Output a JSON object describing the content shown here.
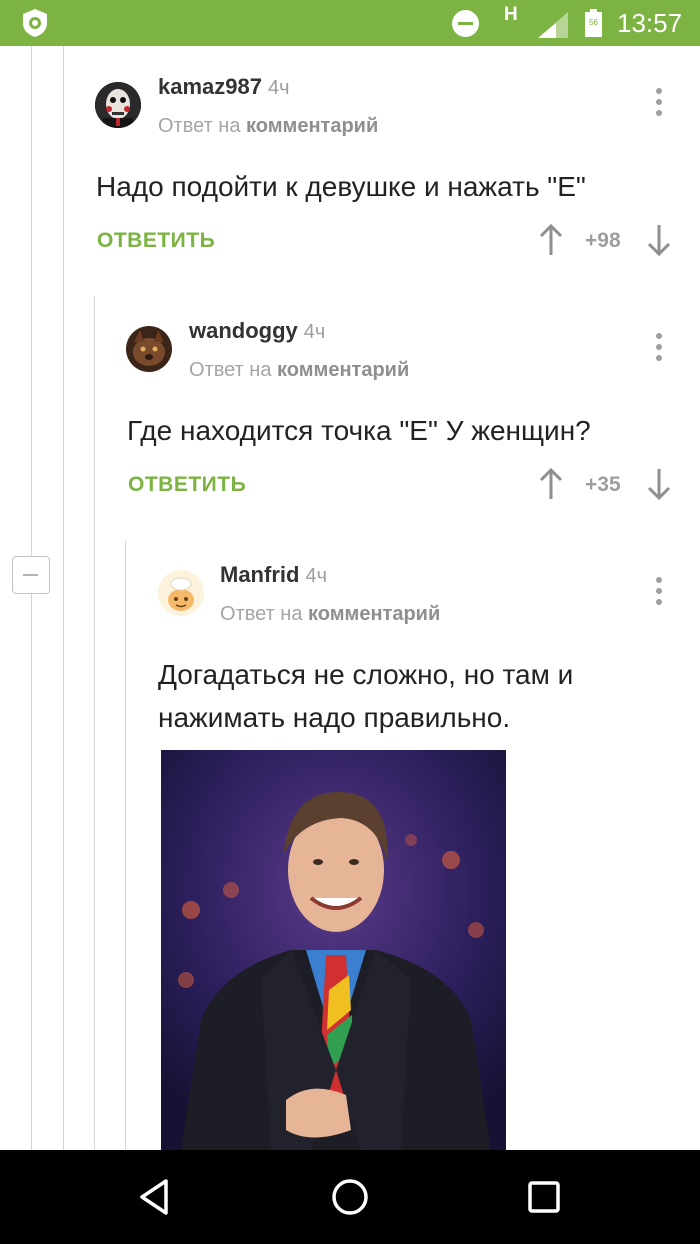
{
  "status_bar": {
    "network": "H",
    "battery_level": "56",
    "time": "13:57",
    "accent_color": "#7cb342"
  },
  "comments": [
    {
      "author": "kamaz987",
      "age": "4ч",
      "reply_prefix": "Ответ на",
      "reply_target": "комментарий",
      "text": "Надо подойти к девушке и нажать \"Е\"",
      "reply_label": "ОТВЕТИТЬ",
      "rating": "+98"
    },
    {
      "author": "wandoggy",
      "age": "4ч",
      "reply_prefix": "Ответ на",
      "reply_target": "комментарий",
      "text": "Где находится точка \"Е\" У женщин?",
      "reply_label": "ОТВЕТИТЬ",
      "rating": "+35"
    },
    {
      "author": "Manfrid",
      "age": "4ч",
      "reply_prefix": "Ответ на",
      "reply_target": "комментарий",
      "text_lines": [
        "Догадаться не сложно, но там и",
        "нажимать надо правильно."
      ]
    }
  ],
  "icons": {
    "app_logo": "pikabu-logo-icon",
    "more": "more-vertical-icon",
    "upvote": "arrow-up-icon",
    "downvote": "arrow-down-icon",
    "collapse": "collapse-minus-icon",
    "nav_back": "back-triangle-icon",
    "nav_home": "home-circle-icon",
    "nav_recent": "recent-square-icon"
  }
}
